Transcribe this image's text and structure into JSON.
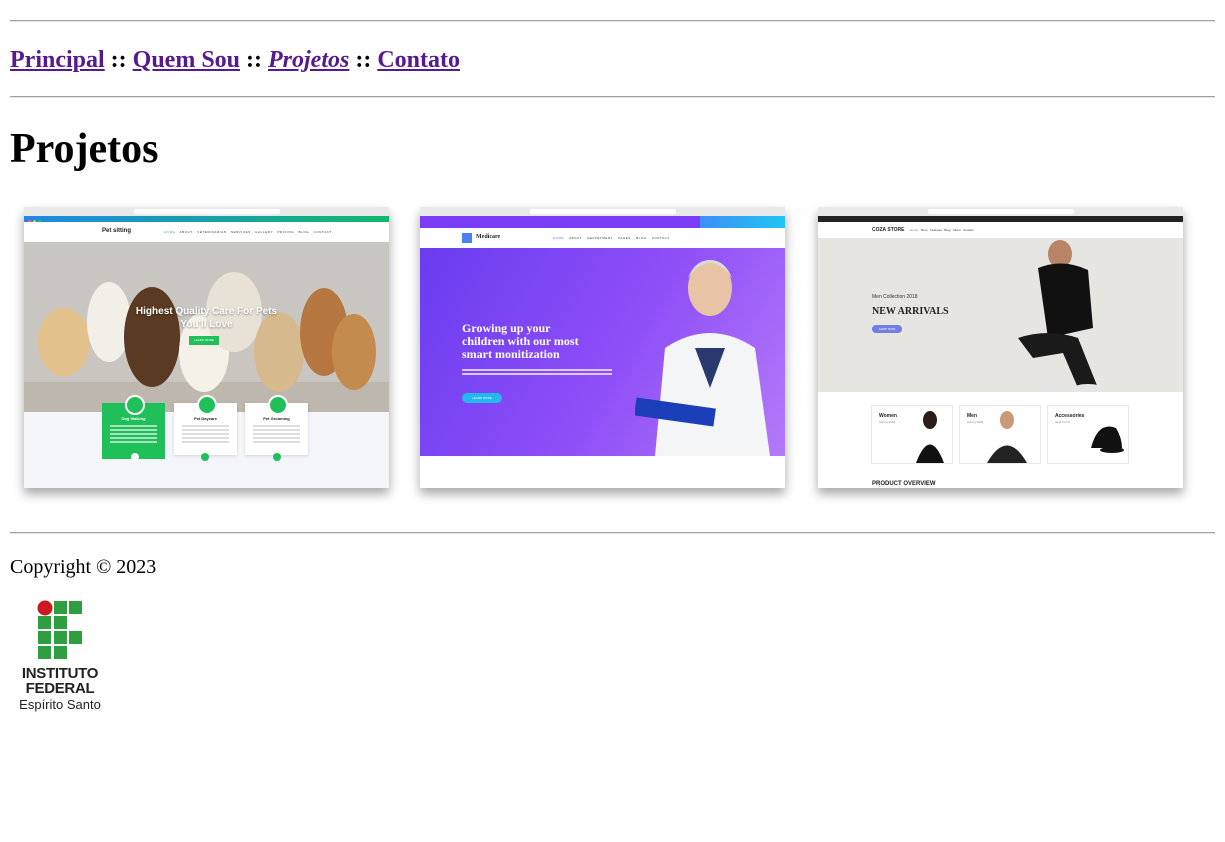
{
  "nav": {
    "items": [
      {
        "label": "Principal"
      },
      {
        "label": "Quem Sou"
      },
      {
        "label": "Projetos"
      },
      {
        "label": "Contato"
      }
    ],
    "separator": "::"
  },
  "page_title": "Projetos",
  "projects": [
    {
      "name": "Pet sitting",
      "menu": [
        "HOME",
        "ABOUT",
        "VETERINARIAN",
        "SERVICES",
        "GALLERY",
        "PRICING",
        "BLOG",
        "CONTACT"
      ],
      "hero_line1": "Highest Quality Care For Pets",
      "hero_line2": "You'll Love",
      "hero_button": "LEARN MORE",
      "cards": [
        {
          "title": "Dog Walking"
        },
        {
          "title": "Pet Daycare"
        },
        {
          "title": "Pet Grooming"
        }
      ],
      "accent_color": "#1fbf5a"
    },
    {
      "name": "Medicare",
      "menu": [
        "HOME",
        "ABOUT",
        "DEPARTMENT",
        "PAGES",
        "BLOG",
        "CONTACT"
      ],
      "hero_line1": "Growing up your",
      "hero_line2": "children with our most",
      "hero_line3": "smart monitization",
      "hero_button": "LEARN MORE",
      "accent_color": "#7b3cf5"
    },
    {
      "name": "COZA STORE",
      "menu": [
        "Home",
        "Shop",
        "Features",
        "Blog",
        "About",
        "Contact"
      ],
      "hero_small": "Men Collection 2018",
      "hero_title": "NEW ARRIVALS",
      "hero_button": "SHOP NOW",
      "categories": [
        {
          "title": "Women",
          "sub": "Spring 2018"
        },
        {
          "title": "Men",
          "sub": "Spring 2018"
        },
        {
          "title": "Accessories",
          "sub": "New Trend"
        }
      ],
      "section": "PRODUCT OVERVIEW",
      "accent_color": "#717fe0"
    }
  ],
  "footer": {
    "copyright": "Copyright © 2023",
    "logo_line1": "INSTITUTO",
    "logo_line2": "FEDERAL",
    "logo_line3": "Espírito Santo",
    "logo_green": "#2f9e41",
    "logo_red": "#cd191e"
  }
}
